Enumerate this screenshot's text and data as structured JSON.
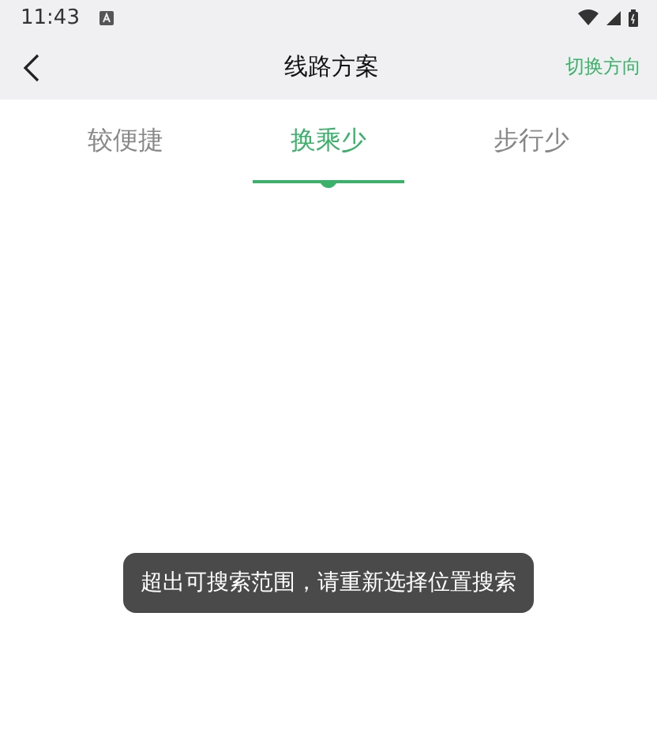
{
  "status_bar": {
    "time": "11:43"
  },
  "header": {
    "title": "线路方案",
    "action": "切换方向"
  },
  "tabs": [
    {
      "label": "较便捷",
      "selected": false
    },
    {
      "label": "换乘少",
      "selected": true
    },
    {
      "label": "步行少",
      "selected": false
    }
  ],
  "toast": {
    "text": "超出可搜索范围，请重新选择位置搜索"
  }
}
